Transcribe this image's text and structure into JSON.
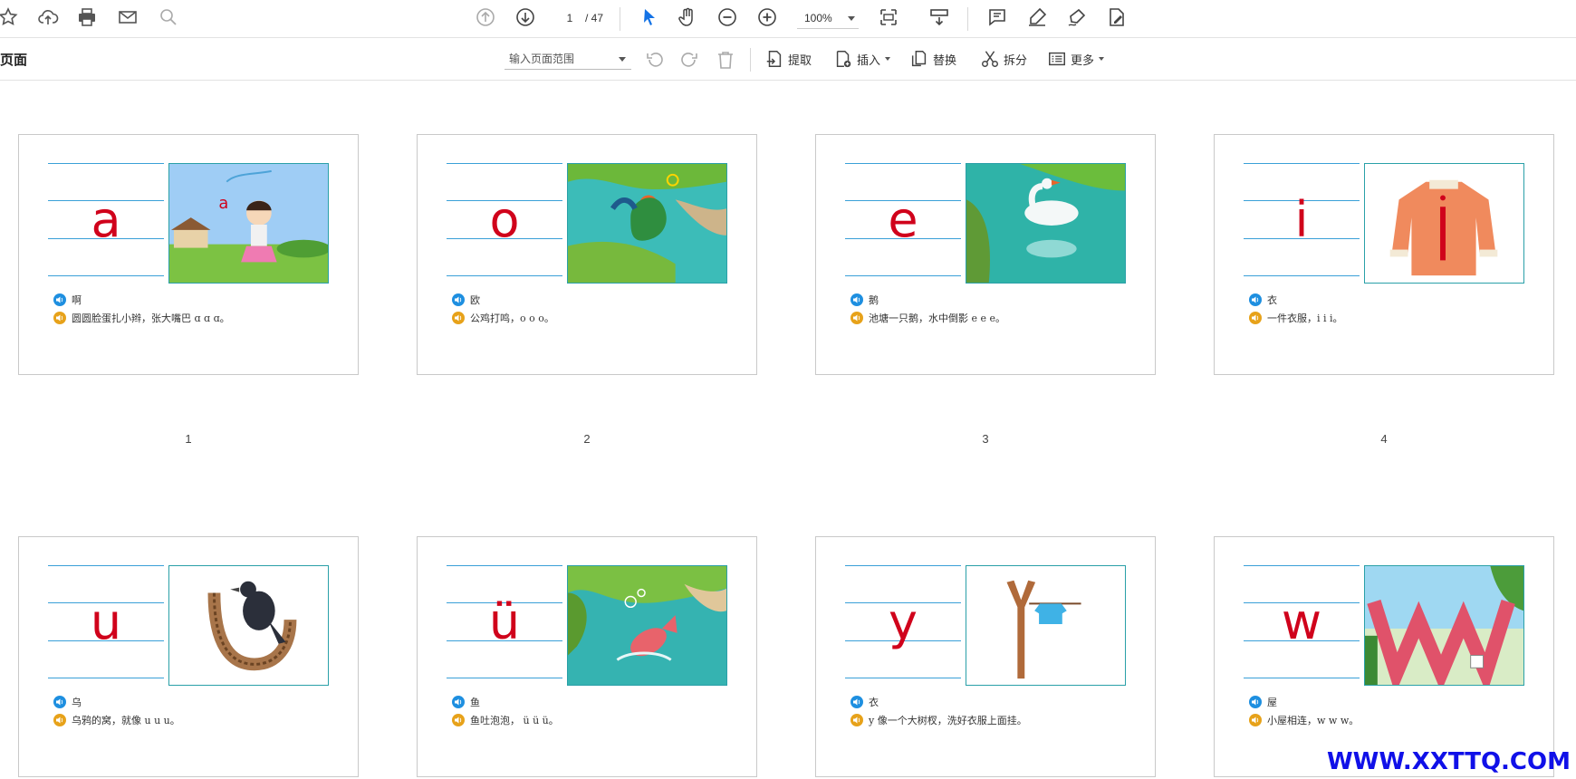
{
  "toolbar": {
    "current_page": "1",
    "total_pages": "/ 47",
    "zoom": "100%"
  },
  "pages_panel": {
    "title": "页面",
    "range_placeholder": "输入页面范围",
    "extract": "提取",
    "insert": "插入",
    "replace": "替换",
    "split": "拆分",
    "more": "更多"
  },
  "pages": [
    {
      "num": "1",
      "letter": "a",
      "word": "啊",
      "rhyme": "圆圆脸蛋扎小辫，张大嘴巴 ɑ ɑ ɑ。"
    },
    {
      "num": "2",
      "letter": "o",
      "word": "欧",
      "rhyme": "公鸡打鸣，o o o。"
    },
    {
      "num": "3",
      "letter": "e",
      "word": "鹅",
      "rhyme": "池塘一只鹅，水中倒影 e e e。"
    },
    {
      "num": "4",
      "letter": "i",
      "word": "衣",
      "rhyme": "一件衣服，i i i。"
    },
    {
      "num": "",
      "letter": "u",
      "word": "乌",
      "rhyme": "乌鸦的窝，就像 u u u。"
    },
    {
      "num": "",
      "letter": "ü",
      "word": "鱼",
      "rhyme": "鱼吐泡泡， ü ü ü。"
    },
    {
      "num": "",
      "letter": "y",
      "word": "衣",
      "rhyme": "y 像一个大树杈，洗好衣服上面挂。"
    },
    {
      "num": "",
      "letter": "w",
      "word": "屋",
      "rhyme": "小屋相连，w w w。"
    }
  ],
  "watermark": "WWW.XXTTQ.COM"
}
